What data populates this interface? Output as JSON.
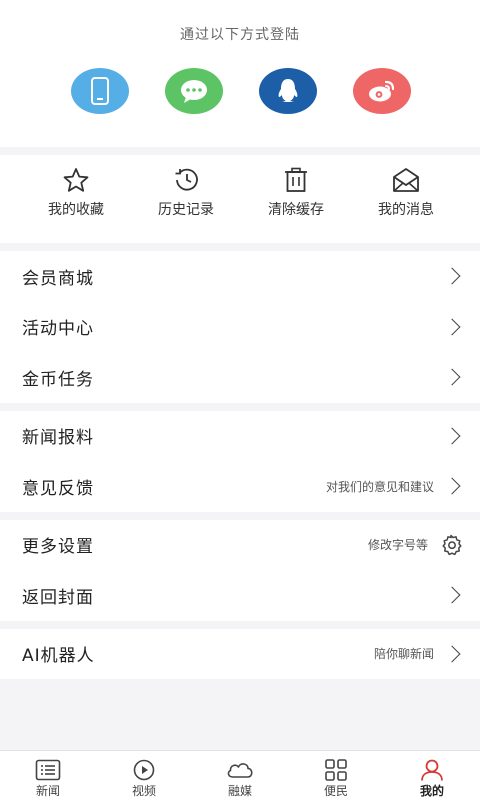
{
  "login": {
    "title": "通过以下方式登陆",
    "methods": [
      {
        "icon": "phone-icon",
        "color": "#55aee6"
      },
      {
        "icon": "wechat-icon",
        "color": "#5cc464"
      },
      {
        "icon": "qq-icon",
        "color": "#1c5fa8"
      },
      {
        "icon": "weibo-icon",
        "color": "#ef6666"
      }
    ]
  },
  "quick": [
    {
      "label": "我的收藏",
      "icon": "star-icon"
    },
    {
      "label": "历史记录",
      "icon": "history-icon"
    },
    {
      "label": "清除缓存",
      "icon": "trash-icon"
    },
    {
      "label": "我的消息",
      "icon": "mail-icon"
    }
  ],
  "groups": [
    [
      {
        "label": "会员商城",
        "hint": ""
      },
      {
        "label": "活动中心",
        "hint": ""
      },
      {
        "label": "金币任务",
        "hint": ""
      }
    ],
    [
      {
        "label": "新闻报料",
        "hint": ""
      },
      {
        "label": "意见反馈",
        "hint": "对我们的意见和建议"
      }
    ],
    [
      {
        "label": "更多设置",
        "hint": "修改字号等"
      },
      {
        "label": "返回封面",
        "hint": ""
      }
    ],
    [
      {
        "label": "AI机器人",
        "hint": "陪你聊新闻"
      }
    ]
  ],
  "tabs": [
    {
      "label": "新闻",
      "icon": "news-list-icon"
    },
    {
      "label": "视频",
      "icon": "video-play-icon"
    },
    {
      "label": "融媒",
      "icon": "cloud-icon"
    },
    {
      "label": "便民",
      "icon": "grid-icon"
    },
    {
      "label": "我的",
      "icon": "person-icon",
      "active": true
    }
  ],
  "colors": {
    "accent": "#d43a3a",
    "background": "#f4f4f6"
  }
}
